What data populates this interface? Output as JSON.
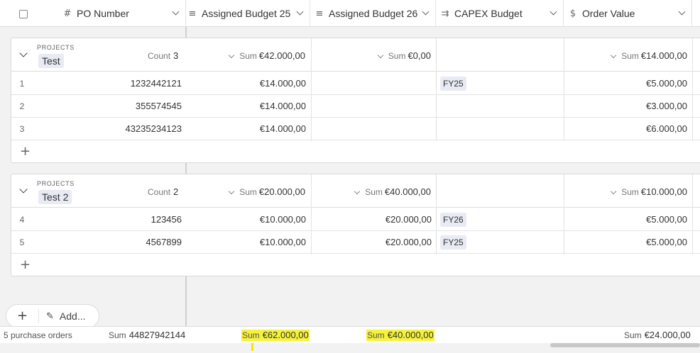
{
  "columns": {
    "po_number": "PO Number",
    "assigned_budget_25": "Assigned Budget 25",
    "assigned_budget_26": "Assigned Budget 26",
    "capex_budget": "CAPEX Budget",
    "order_value": "Order Value"
  },
  "icons": {
    "po_number": "hash-icon",
    "assigned_budget_25": "lookup-icon",
    "assigned_budget_26": "lookup-icon",
    "capex_budget": "rollup-icon",
    "order_value": "dollar-icon"
  },
  "groups": [
    {
      "category": "PROJECTS",
      "name": "Test",
      "count_label": "Count",
      "count": "3",
      "sum_label": "Sum",
      "sum_budget25": "€42.000,00",
      "sum_budget26": "€0,00",
      "sum_order": "€14.000,00",
      "rows": [
        {
          "n": "1",
          "po": "1232442121",
          "b25": "€14.000,00",
          "b26": "",
          "capex": "FY25",
          "order": "€5.000,00"
        },
        {
          "n": "2",
          "po": "355574545",
          "b25": "€14.000,00",
          "b26": "",
          "capex": "",
          "order": "€3.000,00"
        },
        {
          "n": "3",
          "po": "43235234123",
          "b25": "€14.000,00",
          "b26": "",
          "capex": "",
          "order": "€6.000,00"
        }
      ]
    },
    {
      "category": "PROJECTS",
      "name": "Test 2",
      "count_label": "Count",
      "count": "2",
      "sum_label": "Sum",
      "sum_budget25": "€20.000,00",
      "sum_budget26": "€40.000,00",
      "sum_order": "€10.000,00",
      "rows": [
        {
          "n": "4",
          "po": "123456",
          "b25": "€10.000,00",
          "b26": "€20.000,00",
          "capex": "FY26",
          "order": "€5.000,00"
        },
        {
          "n": "5",
          "po": "4567899",
          "b25": "€10.000,00",
          "b26": "€20.000,00",
          "capex": "FY25",
          "order": "€5.000,00"
        }
      ]
    }
  ],
  "add_row_symbol": "+",
  "toolbar": {
    "add_symbol": "+",
    "add_label": "Add..."
  },
  "footer": {
    "record_count": "5 purchase orders",
    "sum_label": "Sum",
    "po_sum": "44827942144",
    "budget25_sum": "€62.000,00",
    "budget26_sum": "€40.000,00",
    "order_sum": "€24.000,00"
  },
  "colors": {
    "tag_bg": "#e8eaf4",
    "highlight": "#f6f23c",
    "marker": "#f0e600"
  }
}
